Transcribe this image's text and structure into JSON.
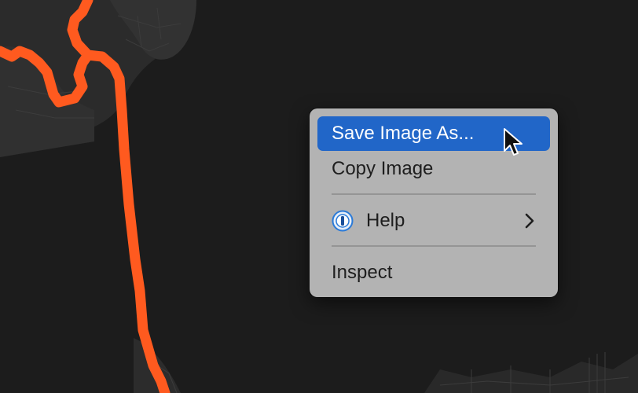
{
  "context_menu": {
    "items": [
      {
        "label": "Save Image As...",
        "highlighted": true
      },
      {
        "label": "Copy Image"
      },
      {
        "label": "Help",
        "icon": "1password-icon",
        "has_submenu": true
      },
      {
        "label": "Inspect"
      }
    ]
  },
  "colors": {
    "route": "#ff5a1f",
    "map_background": "#1c1c1c",
    "land": "#2e2e2e",
    "menu_background": "#b3b3b3",
    "highlight": "#2166c8"
  },
  "icons": {
    "help": "1password-icon",
    "submenu": "chevron-right-icon",
    "pointer": "mouse-cursor-icon"
  }
}
